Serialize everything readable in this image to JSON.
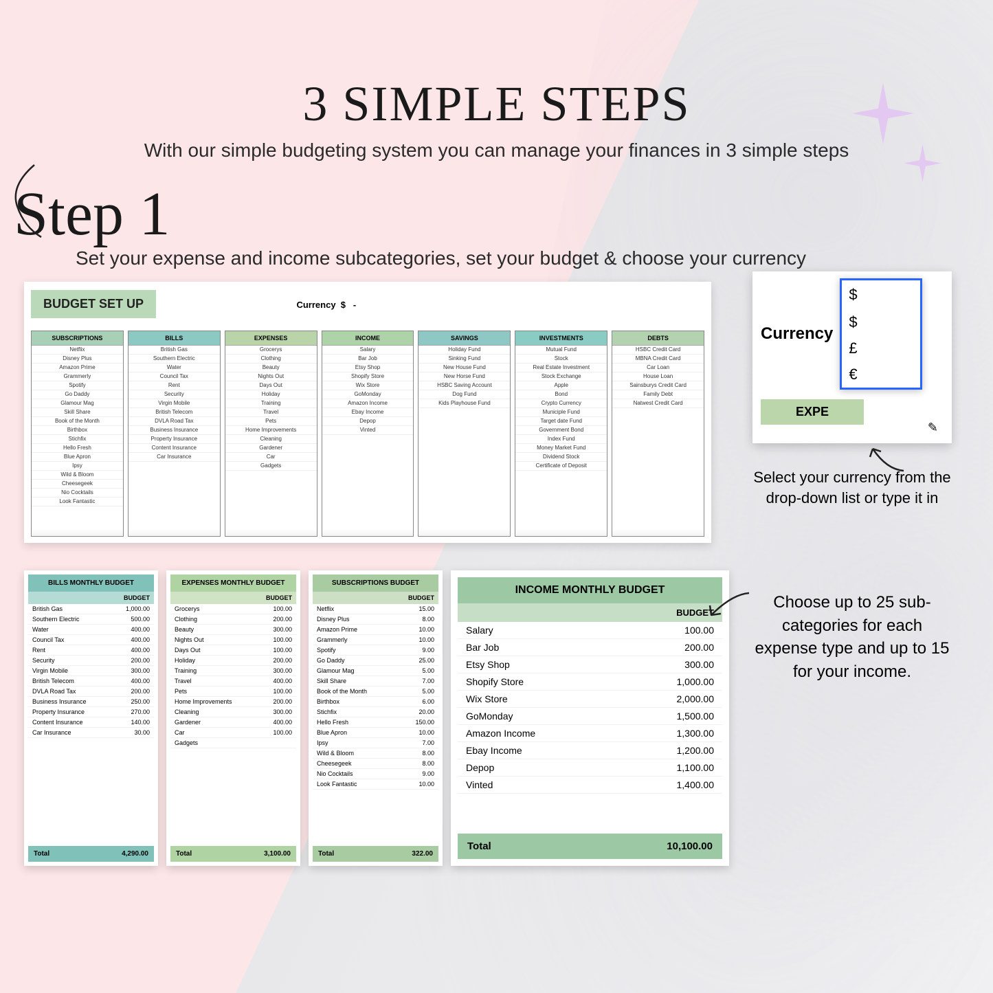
{
  "header": {
    "title": "3 SIMPLE STEPS",
    "subtitle": "With our simple budgeting system you can manage your finances in 3 simple steps"
  },
  "step": {
    "label": "Step 1",
    "description": "Set your expense and income subcategories, set your budget & choose your currency"
  },
  "setup": {
    "title": "BUDGET SET UP",
    "currency_label": "Currency",
    "currency_value": "$",
    "columns": [
      {
        "head": "SUBSCRIPTIONS",
        "class": "h-green1",
        "items": [
          "Netflix",
          "Disney Plus",
          "Amazon Prime",
          "Grammerly",
          "Spotify",
          "Go Daddy",
          "Glamour Mag",
          "Skill Share",
          "Book of the Month",
          "Birthbox",
          "Stichfix",
          "Hello Fresh",
          "Blue Apron",
          "Ipsy",
          "Wild & Bloom",
          "Cheesegeek",
          "Nio Cocktails",
          "Look Fantastic"
        ]
      },
      {
        "head": "BILLS",
        "class": "h-teal",
        "items": [
          "British Gas",
          "Southern Electric",
          "Water",
          "Council Tax",
          "Rent",
          "Security",
          "Virgin Mobile",
          "British Telecom",
          "DVLA Road Tax",
          "Business Insurance",
          "Property Insurance",
          "Content Insurance",
          "Car Insurance"
        ]
      },
      {
        "head": "EXPENSES",
        "class": "h-green2",
        "items": [
          "Grocerys",
          "Clothing",
          "Beauty",
          "Nights Out",
          "Days Out",
          "Holiday",
          "Training",
          "Travel",
          "Pets",
          "Home Improvements",
          "Cleaning",
          "Gardener",
          "Car",
          "Gadgets"
        ]
      },
      {
        "head": "INCOME",
        "class": "h-green3",
        "items": [
          "Salary",
          "Bar Job",
          "Etsy Shop",
          "Shopify Store",
          "Wix Store",
          "GoMonday",
          "Amazon Income",
          "Ebay Income",
          "Depop",
          "Vinted"
        ]
      },
      {
        "head": "SAVINGS",
        "class": "h-teal2",
        "items": [
          "Holiday Fund",
          "Sinking Fund",
          "New House Fund",
          "New Horse Fund",
          "HSBC Saving Account",
          "Dog Fund",
          "Kids Playhouse Fund"
        ]
      },
      {
        "head": "INVESTMENTS",
        "class": "h-teal3",
        "items": [
          "Mutual Fund",
          "Stock",
          "Real Estate Investment",
          "Stock Exchange",
          "Apple",
          "Bond",
          "Crypto Currency",
          "Municiple Fund",
          "Target date Fund",
          "Government Bond",
          "Index Fund",
          "Money Market Fund",
          "Dividend Stock",
          "Certificate of Deposit"
        ]
      },
      {
        "head": "DEBTS",
        "class": "h-green4",
        "items": [
          "HSBC Credit Card",
          "MBNA Credit Card",
          "Car Loan",
          "House Loan",
          "Sainsburys Credit Card",
          "Family Debt",
          "Natwest Credit Card"
        ]
      }
    ]
  },
  "currency_picker": {
    "label": "Currency",
    "selected": "$",
    "options": [
      "$",
      "£",
      "€"
    ],
    "expenses_label": "EXPE",
    "caption": "Select your currency from the drop-down list or type it in"
  },
  "budgets": {
    "budget_col_label": "BUDGET",
    "total_label": "Total",
    "bills": {
      "title": "BILLS MONTHLY BUDGET",
      "rows": [
        [
          "British Gas",
          "1,000.00"
        ],
        [
          "Southern Electric",
          "500.00"
        ],
        [
          "Water",
          "400.00"
        ],
        [
          "Council Tax",
          "400.00"
        ],
        [
          "Rent",
          "400.00"
        ],
        [
          "Security",
          "200.00"
        ],
        [
          "Virgin Mobile",
          "300.00"
        ],
        [
          "British Telecom",
          "400.00"
        ],
        [
          "DVLA Road Tax",
          "200.00"
        ],
        [
          "Business Insurance",
          "250.00"
        ],
        [
          "Property Insurance",
          "270.00"
        ],
        [
          "Content Insurance",
          "140.00"
        ],
        [
          "Car Insurance",
          "30.00"
        ]
      ],
      "total": "4,290.00"
    },
    "expenses": {
      "title": "EXPENSES MONTHLY BUDGET",
      "rows": [
        [
          "Grocerys",
          "100.00"
        ],
        [
          "Clothing",
          "200.00"
        ],
        [
          "Beauty",
          "300.00"
        ],
        [
          "Nights Out",
          "100.00"
        ],
        [
          "Days Out",
          "100.00"
        ],
        [
          "Holiday",
          "200.00"
        ],
        [
          "Training",
          "300.00"
        ],
        [
          "Travel",
          "400.00"
        ],
        [
          "Pets",
          "100.00"
        ],
        [
          "Home Improvements",
          "200.00"
        ],
        [
          "Cleaning",
          "300.00"
        ],
        [
          "Gardener",
          "400.00"
        ],
        [
          "Car",
          "100.00"
        ],
        [
          "Gadgets",
          ""
        ]
      ],
      "total": "3,100.00"
    },
    "subscriptions": {
      "title": "SUBSCRIPTIONS BUDGET",
      "rows": [
        [
          "Netflix",
          "15.00"
        ],
        [
          "Disney Plus",
          "8.00"
        ],
        [
          "Amazon Prime",
          "10.00"
        ],
        [
          "Grammerly",
          "10.00"
        ],
        [
          "Spotify",
          "9.00"
        ],
        [
          "Go Daddy",
          "25.00"
        ],
        [
          "Glamour Mag",
          "5.00"
        ],
        [
          "Skill Share",
          "7.00"
        ],
        [
          "Book of the Month",
          "5.00"
        ],
        [
          "Birthbox",
          "6.00"
        ],
        [
          "Stichfix",
          "20.00"
        ],
        [
          "Hello Fresh",
          "150.00"
        ],
        [
          "Blue Apron",
          "10.00"
        ],
        [
          "Ipsy",
          "7.00"
        ],
        [
          "Wild & Bloom",
          "8.00"
        ],
        [
          "Cheesegeek",
          "8.00"
        ],
        [
          "Nio Cocktails",
          "9.00"
        ],
        [
          "Look Fantastic",
          "10.00"
        ]
      ],
      "total": "322.00"
    },
    "income": {
      "title": "INCOME MONTHLY BUDGET",
      "rows": [
        [
          "Salary",
          "100.00"
        ],
        [
          "Bar Job",
          "200.00"
        ],
        [
          "Etsy Shop",
          "300.00"
        ],
        [
          "Shopify Store",
          "1,000.00"
        ],
        [
          "Wix Store",
          "2,000.00"
        ],
        [
          "GoMonday",
          "1,500.00"
        ],
        [
          "Amazon Income",
          "1,300.00"
        ],
        [
          "Ebay Income",
          "1,200.00"
        ],
        [
          "Depop",
          "1,100.00"
        ],
        [
          "Vinted",
          "1,400.00"
        ]
      ],
      "total": "10,100.00"
    }
  },
  "right_caption": "Choose up to 25 sub-categories for each expense type and up to 15 for your income."
}
